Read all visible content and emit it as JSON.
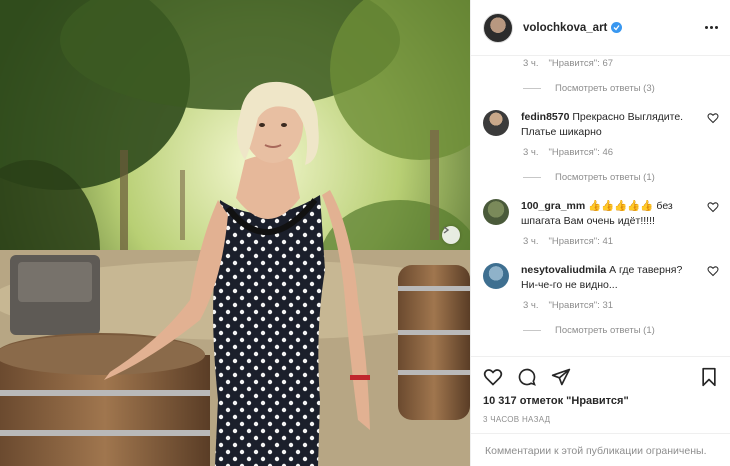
{
  "post": {
    "username": "volochkova_art",
    "verified_icon": "verified-badge-icon",
    "more_icon": "more-options-icon"
  },
  "comments": [
    {
      "type": "meta",
      "time": "3 ч.",
      "likes": "\"Нравится\": 67"
    },
    {
      "type": "replies",
      "label": "Посмотреть ответы (3)"
    },
    {
      "type": "comment",
      "user": "fedin8570",
      "text": "Прекрасно Выглядите. Платье шикарно",
      "time": "3 ч.",
      "likes": "\"Нравится\": 46",
      "replies": "Посмотреть ответы (1)"
    },
    {
      "type": "comment",
      "user": "100_gra_mm",
      "text": "👍👍👍👍👍 без шпагата Вам очень идёт!!!!!",
      "time": "3 ч.",
      "likes": "\"Нравится\": 41"
    },
    {
      "type": "comment",
      "user": "nesytovaliudmila",
      "text": "А где таверня? Ни-че-го не видно...",
      "time": "3 ч.",
      "likes": "\"Нравится\": 31",
      "replies": "Посмотреть ответы (1)"
    }
  ],
  "actions": {
    "like_icon": "heart-icon",
    "comment_icon": "comment-icon",
    "share_icon": "share-icon",
    "save_icon": "bookmark-icon"
  },
  "likes_count": "10 317 отметок \"Нравится\"",
  "posted_time": "3 ЧАСОВ НАЗАД",
  "comments_limited": "Комментарии к этой публикации ограничены.",
  "colors": {
    "accent": "#3897f0",
    "muted": "#8e8e8e",
    "text": "#262626",
    "border": "#efefef"
  }
}
